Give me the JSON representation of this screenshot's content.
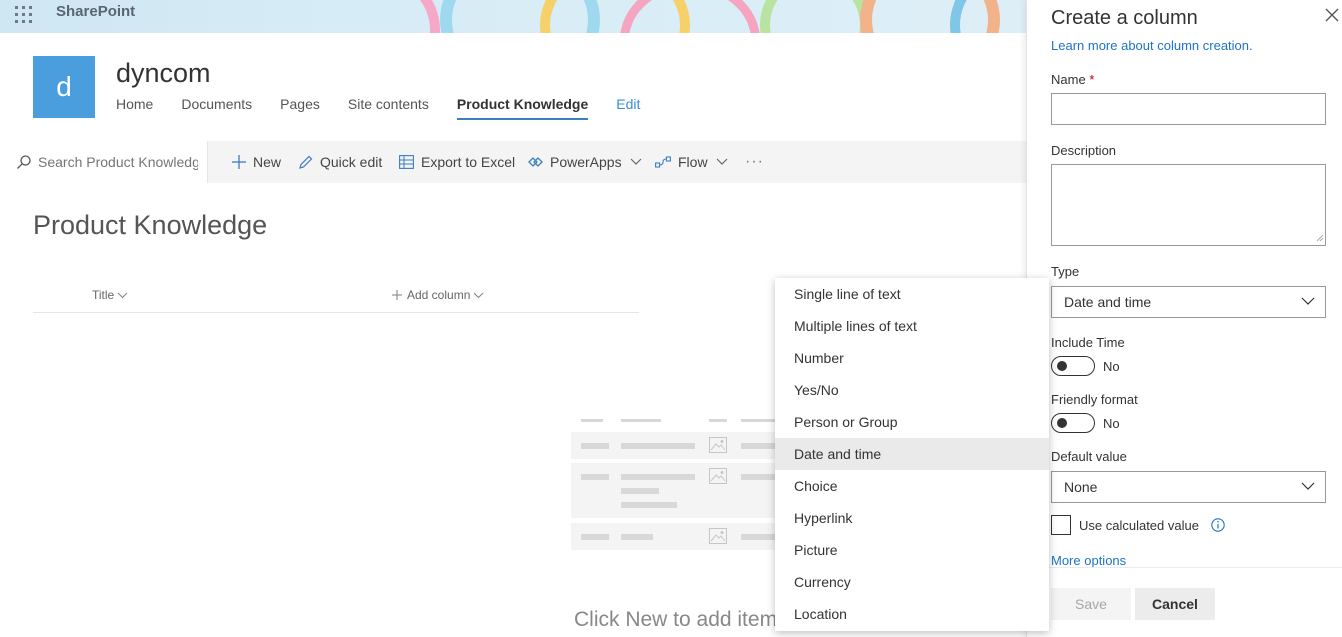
{
  "suite": {
    "brand": "SharePoint"
  },
  "site": {
    "logo_letter": "d",
    "title": "dyncom",
    "nav": [
      "Home",
      "Documents",
      "Pages",
      "Site contents",
      "Product Knowledge",
      "Edit"
    ],
    "active_nav": "Product Knowledge"
  },
  "commandbar": {
    "search_placeholder": "Search Product Knowledge",
    "new_label": "New",
    "quick_edit_label": "Quick edit",
    "export_label": "Export to Excel",
    "powerapps_label": "PowerApps",
    "flow_label": "Flow",
    "more_label": "···"
  },
  "list": {
    "title": "Product Knowledge",
    "columns": [
      "Title",
      "Add column"
    ],
    "empty_text": "Click New to add items"
  },
  "type_dropdown": {
    "options": [
      "Single line of text",
      "Multiple lines of text",
      "Number",
      "Yes/No",
      "Person or Group",
      "Date and time",
      "Choice",
      "Hyperlink",
      "Picture",
      "Currency",
      "Location"
    ],
    "selected": "Date and time"
  },
  "panel": {
    "title": "Create a column",
    "learn_more": "Learn more about column creation.",
    "name_label": "Name",
    "name_required_mark": "*",
    "name_value": "",
    "description_label": "Description",
    "description_value": "",
    "type_label": "Type",
    "type_value": "Date and time",
    "include_time_label": "Include Time",
    "include_time_value": "No",
    "friendly_format_label": "Friendly format",
    "friendly_format_value": "No",
    "default_value_label": "Default value",
    "default_value": "None",
    "use_calculated_label": "Use calculated value",
    "more_options": "More options",
    "save_label": "Save",
    "cancel_label": "Cancel"
  },
  "colors": {
    "accent": "#1e73c7",
    "logo": "#4a9ede",
    "suitebar": "#d6ecf6"
  }
}
